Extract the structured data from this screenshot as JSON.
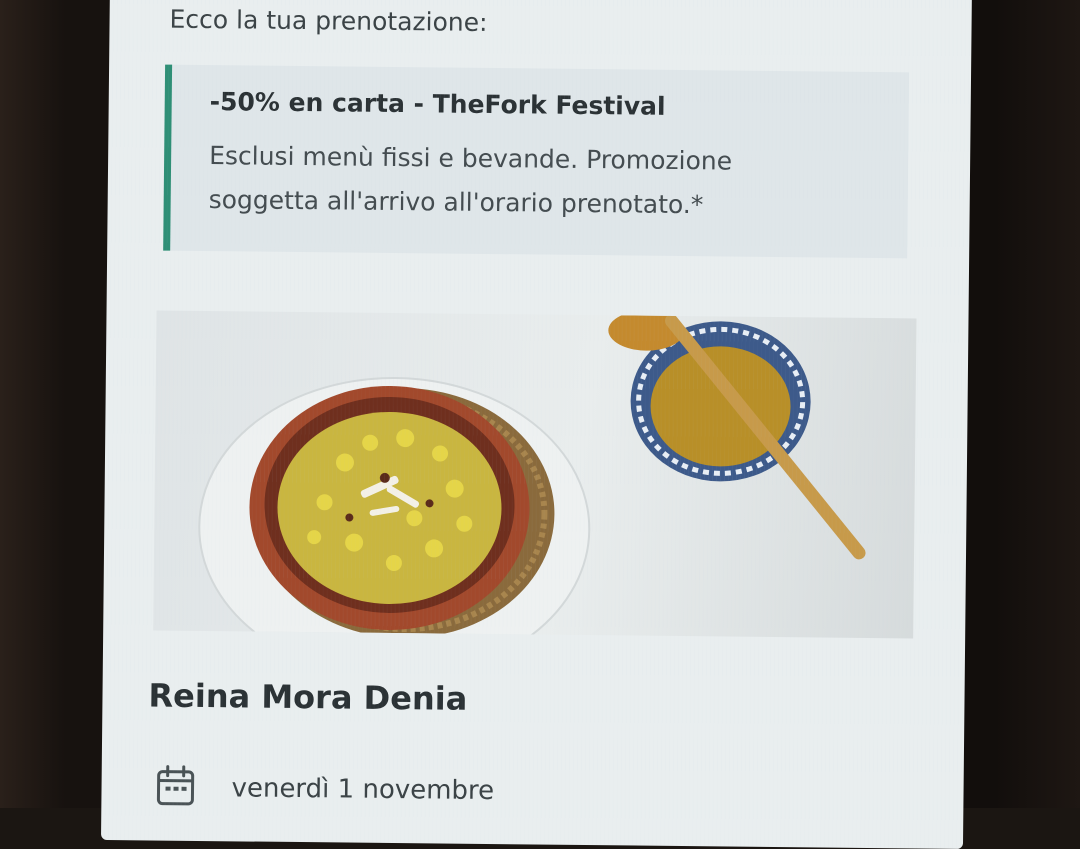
{
  "booking": {
    "intro": "Ecco la tua prenotazione:",
    "promo": {
      "title": "-50% en carta - TheFork Festival",
      "description": "Esclusi menù fissi e bevande. Promozione soggetta all'arrivo all'orario prenotato.*"
    },
    "restaurant": {
      "name": "Reina Mora Denia",
      "photo_icon": "food-photo"
    },
    "date": {
      "icon": "calendar-icon",
      "label": "venerdì 1 novembre"
    }
  },
  "colors": {
    "accent": "#2f8f76",
    "screen_bg": "#e9eeef",
    "promo_bg": "#dfe6e9",
    "text": "#2d3436"
  }
}
